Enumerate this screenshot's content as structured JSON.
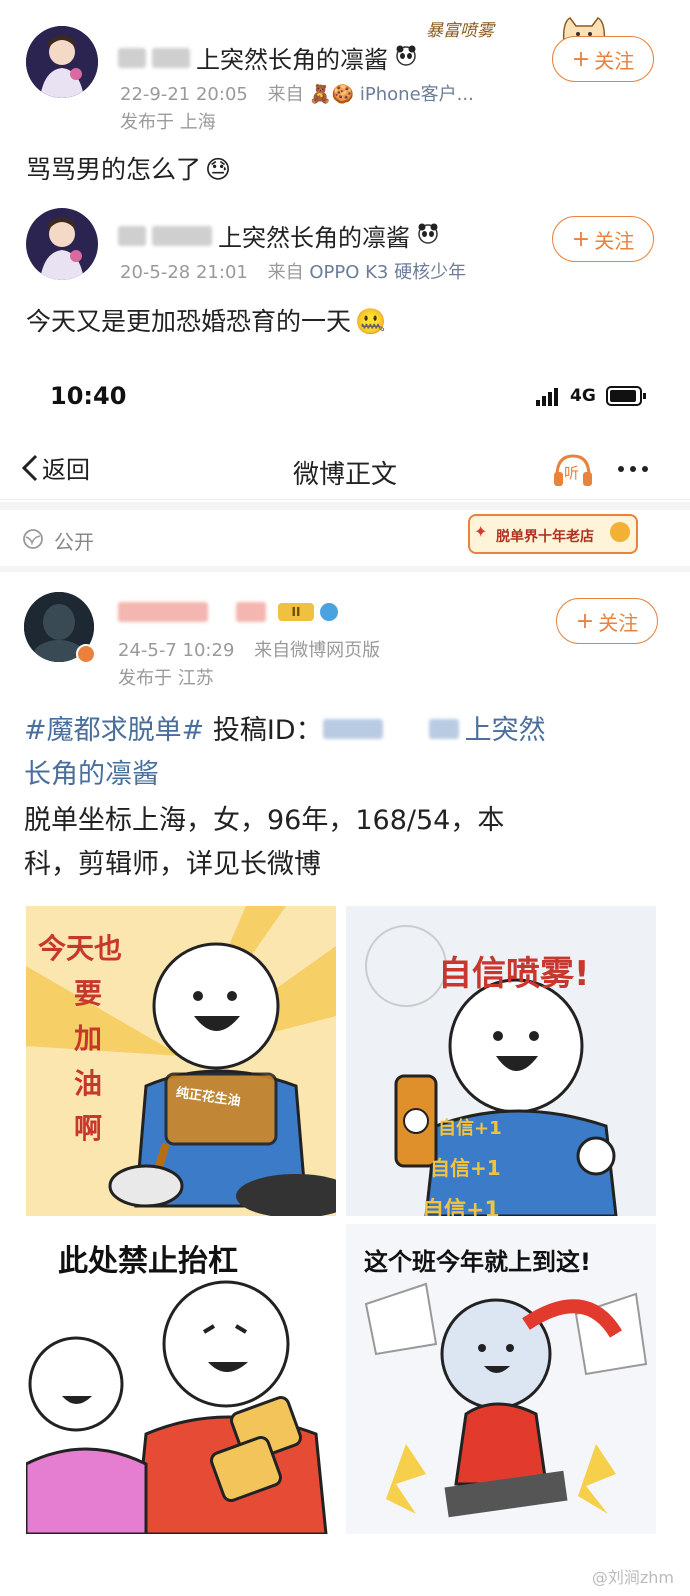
{
  "post1": {
    "name_suffix": "上突然长角的凛酱",
    "meta_time": "22-9-21 20:05",
    "meta_from": "来自",
    "meta_source": "iPhone客户...",
    "location": "发布于 上海",
    "text": "骂骂男的怎么了",
    "follow_label": "关注",
    "badge_text": "暴富喷雾"
  },
  "post2": {
    "name_suffix": "上突然长角的凛酱",
    "meta_time": "20-5-28 21:01",
    "meta_from": "来自",
    "meta_source": "OPPO K3 硬核少年",
    "text": "今天又是更加恐婚恐育的一天",
    "follow_label": "关注"
  },
  "status_bar": {
    "time": "10:40",
    "network": "4G"
  },
  "nav": {
    "back_label": "返回",
    "title": "微博正文",
    "listen_label": "听"
  },
  "visibility": {
    "label": "公开",
    "badge_text": "脱单界十年老店"
  },
  "post3": {
    "meta_time": "24-5-7 10:29",
    "meta_from": "来自",
    "meta_source": "微博网页版",
    "location": "发布于 江苏",
    "follow_label": "关注",
    "hashtag": "#魔都求脱单#",
    "line1_mid": " 投稿ID：",
    "line1_tail": "上突然",
    "line2": "长角的凛酱",
    "line3": "脱单坐标上海，女，96年，168/54，本",
    "line4": "科，剪辑师，详见长微博",
    "level_badge": "II"
  },
  "images": {
    "tile1": {
      "caption_lines": [
        "今天也",
        "要",
        "加",
        "油",
        "啊"
      ],
      "bottle_label": "纯正花生油"
    },
    "tile2": {
      "caption": "自信喷雾!",
      "tags": [
        "自信+1",
        "自信+1",
        "自信+1"
      ]
    },
    "tile3": {
      "caption": "此处禁止抬杠"
    },
    "tile4": {
      "caption": "这个班今年就上到这!"
    }
  },
  "watermark": "@刘涧zhm",
  "colors": {
    "accent": "#e8823d",
    "link": "#4a6f9c",
    "meta": "#9a9a9a",
    "caption_red": "#c8372d"
  }
}
